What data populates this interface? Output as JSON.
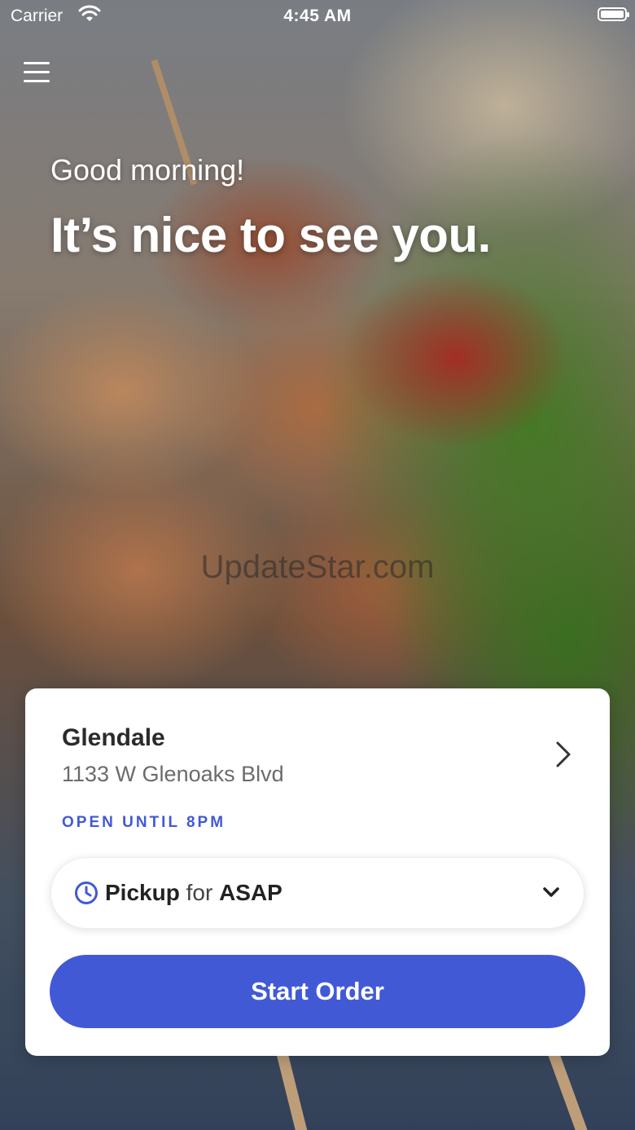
{
  "status_bar": {
    "carrier": "Carrier",
    "time": "4:45 AM"
  },
  "header": {
    "greeting": "Good morning!",
    "headline": "It’s nice to see you."
  },
  "watermark": "UpdateStar.com",
  "location": {
    "name": "Glendale",
    "address": "1133 W Glenoaks Blvd",
    "hours": "OPEN UNTIL 8PM"
  },
  "pickup": {
    "mode": "Pickup",
    "connector": "for",
    "time": "ASAP"
  },
  "start_button": "Start Order",
  "icons": {
    "menu": "hamburger-icon",
    "wifi": "wifi-icon",
    "battery": "battery-icon",
    "chevron": "chevron-right-icon",
    "clock": "clock-icon",
    "dropdown": "chevron-down-icon"
  },
  "colors": {
    "accent": "#4259d6",
    "card_bg": "#ffffff"
  }
}
